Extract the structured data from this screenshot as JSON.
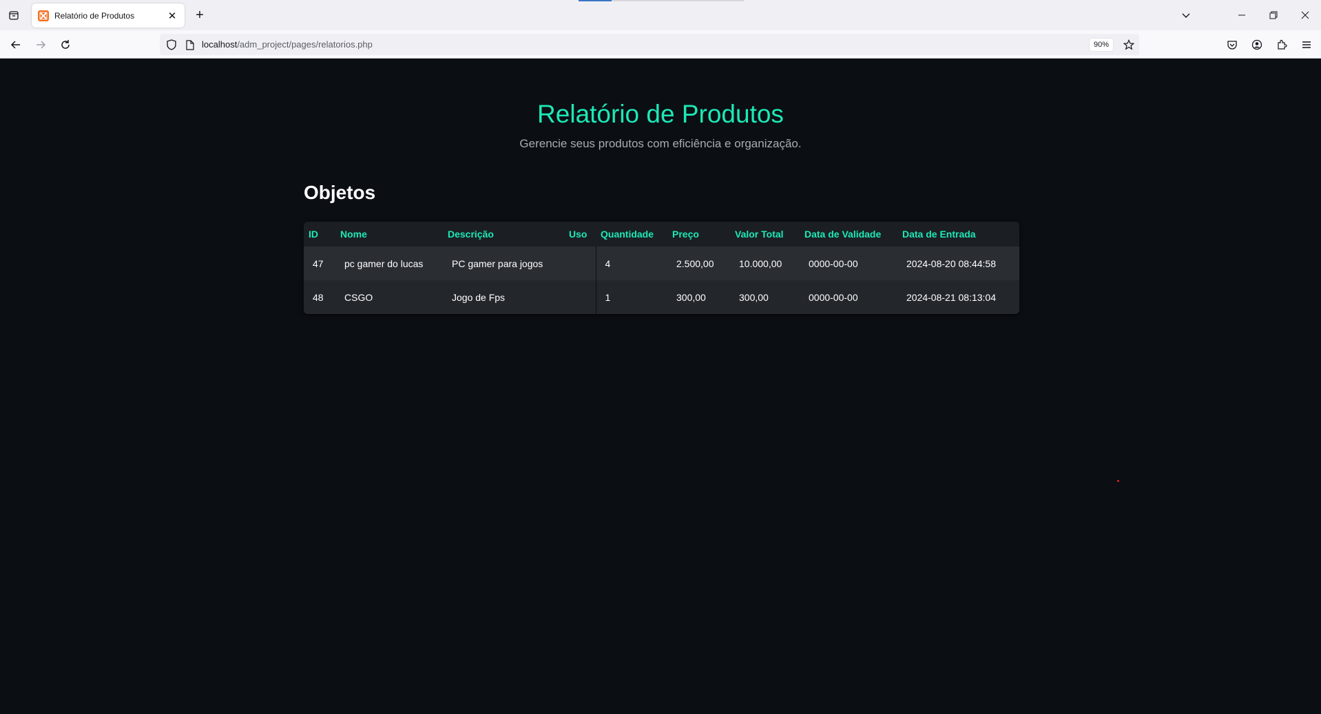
{
  "browser": {
    "tab_title": "Relatório de Produtos",
    "tab_close": "✕",
    "new_tab": "+",
    "url_host": "localhost",
    "url_path": "/adm_project/pages/relatorios.php",
    "zoom": "90%"
  },
  "page": {
    "title": "Relatório de Produtos",
    "subtitle": "Gerencie seus produtos com eficiência e organização.",
    "section_title": "Objetos"
  },
  "table": {
    "headers": [
      "ID",
      "Nome",
      "Descrição",
      "Uso",
      "Quantidade",
      "Preço",
      "Valor Total",
      "Data de Validade",
      "Data de Entrada"
    ],
    "rows": [
      [
        "47",
        "pc gamer do lucas",
        "PC gamer para jogos",
        "",
        "4",
        "2.500,00",
        "10.000,00",
        "0000-00-00",
        "2024-08-20 08:44:58"
      ],
      [
        "48",
        "CSGO",
        "Jogo de Fps",
        "",
        "1",
        "300,00",
        "300,00",
        "0000-00-00",
        "2024-08-21 08:13:04"
      ]
    ]
  },
  "colors": {
    "accent": "#1de9b6",
    "background": "#0b0f14",
    "table_bg": "#23272c"
  },
  "icons": [
    "tab-list-icon",
    "xampp-favicon-icon",
    "close-icon",
    "plus-icon",
    "back-arrow-icon",
    "forward-arrow-icon",
    "reload-icon",
    "shield-icon",
    "page-icon",
    "star-icon",
    "pocket-icon",
    "account-icon",
    "extensions-icon",
    "menu-icon",
    "chevron-down-icon",
    "minimize-icon",
    "restore-icon"
  ]
}
